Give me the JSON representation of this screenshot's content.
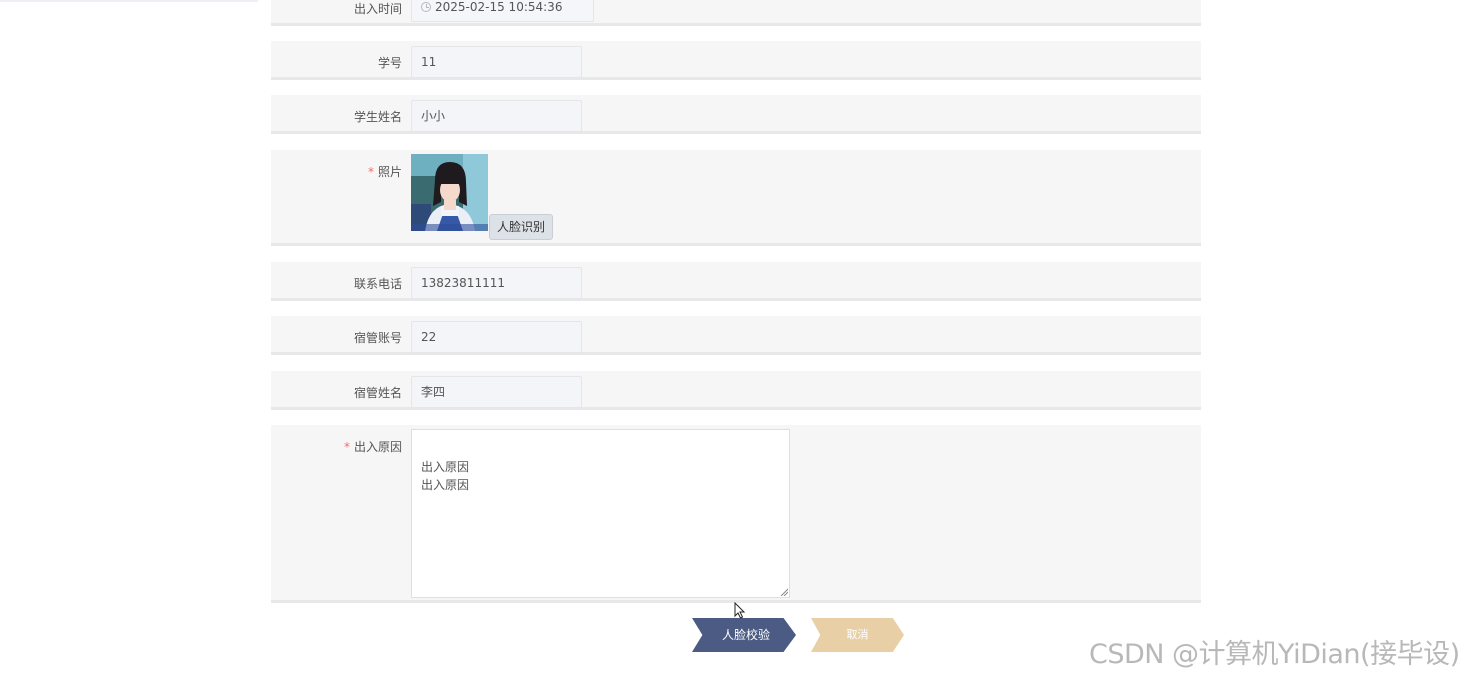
{
  "form": {
    "time": {
      "label": "出入时间",
      "value": "2025-02-15 10:54:36"
    },
    "student_id": {
      "label": "学号",
      "value": "11"
    },
    "student_name": {
      "label": "学生姓名",
      "value": "小小"
    },
    "photo": {
      "required_mark": "*",
      "label": "照片",
      "face_button": "人脸识别"
    },
    "phone": {
      "label": "联系电话",
      "value": "13823811111"
    },
    "manager_account": {
      "label": "宿管账号",
      "value": "22"
    },
    "manager_name": {
      "label": "宿管姓名",
      "value": "李四"
    },
    "reason": {
      "required_mark": "*",
      "label": "出入原因",
      "value": "出入原因\n出入原因"
    }
  },
  "actions": {
    "verify_label": "人脸校验",
    "cancel_label": "取消"
  },
  "watermark": "CSDN @计算机YiDian(接毕设)",
  "icons": {
    "time": "clock-icon",
    "cursor": "mouse-pointer-icon"
  }
}
